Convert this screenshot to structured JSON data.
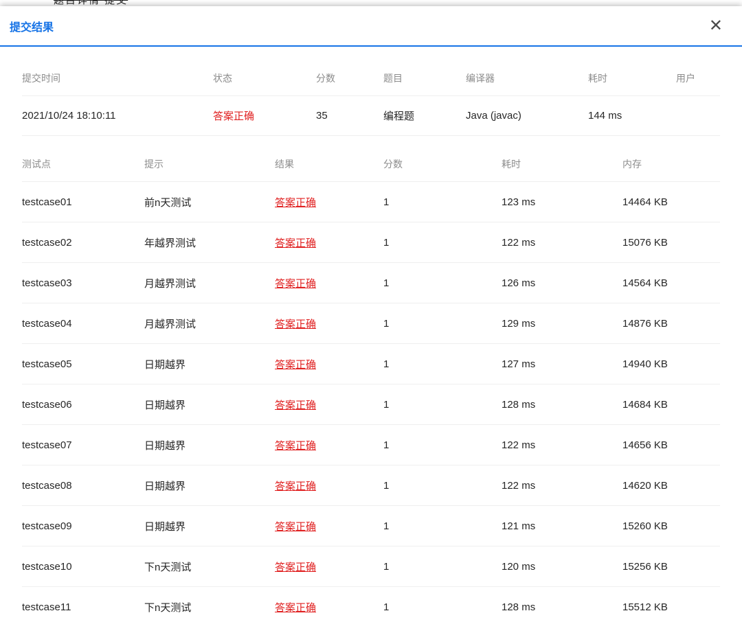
{
  "background": {
    "partial_text": "题目详情 提交"
  },
  "modal": {
    "title": "提交结果",
    "close_icon": "✕",
    "accent_color": "#1673e6",
    "status_color": "#e02020"
  },
  "summary_table": {
    "headers": {
      "time": "提交时间",
      "status": "状态",
      "score": "分数",
      "problem": "题目",
      "compiler": "编译器",
      "elapsed": "耗时",
      "user": "用户"
    },
    "row": {
      "time": "2021/10/24 18:10:11",
      "status": "答案正确",
      "score": "35",
      "problem": "编程题",
      "compiler": "Java (javac)",
      "elapsed": "144 ms",
      "user": ""
    }
  },
  "testcase_table": {
    "headers": {
      "name": "测试点",
      "hint": "提示",
      "result": "结果",
      "score": "分数",
      "time": "耗时",
      "memory": "内存"
    },
    "rows": [
      {
        "name": "testcase01",
        "hint": "前n天测试",
        "result": "答案正确",
        "score": "1",
        "time": "123 ms",
        "memory": "14464 KB"
      },
      {
        "name": "testcase02",
        "hint": "年越界测试",
        "result": "答案正确",
        "score": "1",
        "time": "122 ms",
        "memory": "15076 KB"
      },
      {
        "name": "testcase03",
        "hint": "月越界测试",
        "result": "答案正确",
        "score": "1",
        "time": "126 ms",
        "memory": "14564 KB"
      },
      {
        "name": "testcase04",
        "hint": "月越界测试",
        "result": "答案正确",
        "score": "1",
        "time": "129 ms",
        "memory": "14876 KB"
      },
      {
        "name": "testcase05",
        "hint": "日期越界",
        "result": "答案正确",
        "score": "1",
        "time": "127 ms",
        "memory": "14940 KB"
      },
      {
        "name": "testcase06",
        "hint": "日期越界",
        "result": "答案正确",
        "score": "1",
        "time": "128 ms",
        "memory": "14684 KB"
      },
      {
        "name": "testcase07",
        "hint": "日期越界",
        "result": "答案正确",
        "score": "1",
        "time": "122 ms",
        "memory": "14656 KB"
      },
      {
        "name": "testcase08",
        "hint": "日期越界",
        "result": "答案正确",
        "score": "1",
        "time": "122 ms",
        "memory": "14620 KB"
      },
      {
        "name": "testcase09",
        "hint": "日期越界",
        "result": "答案正确",
        "score": "1",
        "time": "121 ms",
        "memory": "15260 KB"
      },
      {
        "name": "testcase10",
        "hint": "下n天测试",
        "result": "答案正确",
        "score": "1",
        "time": "120 ms",
        "memory": "15256 KB"
      },
      {
        "name": "testcase11",
        "hint": "下n天测试",
        "result": "答案正确",
        "score": "1",
        "time": "128 ms",
        "memory": "15512 KB"
      }
    ]
  }
}
